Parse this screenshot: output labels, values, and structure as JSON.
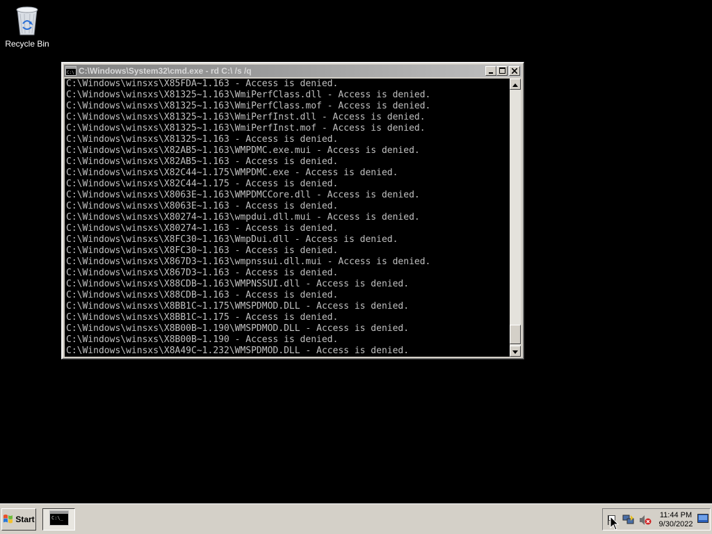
{
  "desktop": {
    "icons": [
      {
        "label": "Recycle Bin",
        "icon": "recycle-bin-icon"
      }
    ]
  },
  "window": {
    "title": "C:\\Windows\\System32\\cmd.exe - rd  C:\\ /s /q",
    "icon": "console-icon",
    "controls": [
      "minimize-icon",
      "maximize-icon",
      "close-icon"
    ]
  },
  "console": {
    "lines": [
      "C:\\Windows\\winsxs\\X85FDA~1.163 - Access is denied.",
      "C:\\Windows\\winsxs\\X81325~1.163\\WmiPerfClass.dll - Access is denied.",
      "C:\\Windows\\winsxs\\X81325~1.163\\WmiPerfClass.mof - Access is denied.",
      "C:\\Windows\\winsxs\\X81325~1.163\\WmiPerfInst.dll - Access is denied.",
      "C:\\Windows\\winsxs\\X81325~1.163\\WmiPerfInst.mof - Access is denied.",
      "C:\\Windows\\winsxs\\X81325~1.163 - Access is denied.",
      "C:\\Windows\\winsxs\\X82AB5~1.163\\WMPDMC.exe.mui - Access is denied.",
      "C:\\Windows\\winsxs\\X82AB5~1.163 - Access is denied.",
      "C:\\Windows\\winsxs\\X82C44~1.175\\WMPDMC.exe - Access is denied.",
      "C:\\Windows\\winsxs\\X82C44~1.175 - Access is denied.",
      "C:\\Windows\\winsxs\\X8063E~1.163\\WMPDMCCore.dll - Access is denied.",
      "C:\\Windows\\winsxs\\X8063E~1.163 - Access is denied.",
      "C:\\Windows\\winsxs\\X80274~1.163\\wmpdui.dll.mui - Access is denied.",
      "C:\\Windows\\winsxs\\X80274~1.163 - Access is denied.",
      "C:\\Windows\\winsxs\\X8FC30~1.163\\WmpDui.dll - Access is denied.",
      "C:\\Windows\\winsxs\\X8FC30~1.163 - Access is denied.",
      "C:\\Windows\\winsxs\\X867D3~1.163\\wmpnssui.dll.mui - Access is denied.",
      "C:\\Windows\\winsxs\\X867D3~1.163 - Access is denied.",
      "C:\\Windows\\winsxs\\X88CDB~1.163\\WMPNSSUI.dll - Access is denied.",
      "C:\\Windows\\winsxs\\X88CDB~1.163 - Access is denied.",
      "C:\\Windows\\winsxs\\X8BB1C~1.175\\WMSPDMOD.DLL - Access is denied.",
      "C:\\Windows\\winsxs\\X8BB1C~1.175 - Access is denied.",
      "C:\\Windows\\winsxs\\X8B00B~1.190\\WMSPDMOD.DLL - Access is denied.",
      "C:\\Windows\\winsxs\\X8B00B~1.190 - Access is denied.",
      "C:\\Windows\\winsxs\\X8A49C~1.232\\WMSPDMOD.DLL - Access is denied."
    ],
    "scroll_position": 0.96
  },
  "taskbar": {
    "start_label": "Start",
    "start_icon": "windows-logo-icon",
    "tasks": [
      {
        "icon": "console-icon"
      }
    ],
    "tray_icons": [
      "flag-icon",
      "network-icon",
      "volume-muted-icon",
      "show-desktop-icon"
    ],
    "clock": {
      "time": "11:44 PM",
      "date": "9/30/2022"
    }
  },
  "colors": {
    "desktop_bg": "#000000",
    "console_bg": "#000000",
    "console_fg": "#c0c0c0",
    "chrome": "#d4d0c8",
    "titlebar_inactive": "#808080"
  }
}
